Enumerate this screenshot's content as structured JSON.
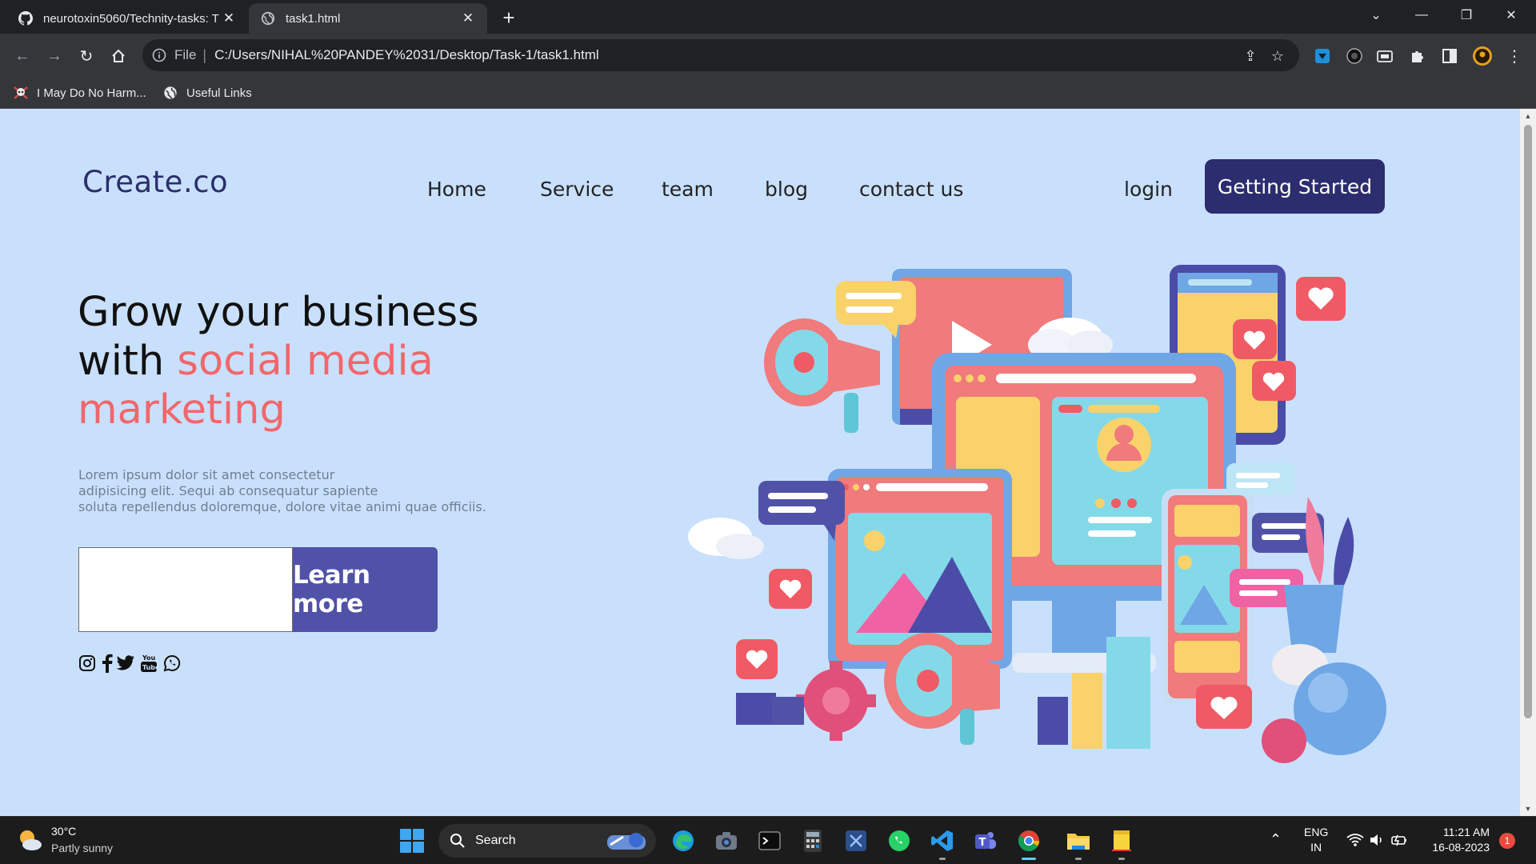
{
  "browser": {
    "tabs": [
      {
        "label": "neurotoxin5060/Technity-tasks: T",
        "icon": "github-icon",
        "active": false
      },
      {
        "label": "task1.html",
        "icon": "globe-icon",
        "active": true
      }
    ],
    "address": {
      "scheme": "File",
      "url": "C:/Users/NIHAL%20PANDEY%2031/Desktop/Task-1/task1.html"
    },
    "bookmarks": [
      {
        "label": "I May Do No Harm...",
        "icon": "skull-icon"
      },
      {
        "label": "Useful Links",
        "icon": "globe-icon"
      }
    ]
  },
  "page": {
    "logo": "Create.co",
    "nav": [
      "Home",
      "Service",
      "team",
      "blog",
      "contact us"
    ],
    "login": "login",
    "cta": "Getting Started",
    "hero": {
      "title_line1": "Grow your business",
      "title_with": "with",
      "title_accent1": "social media",
      "title_accent2": "marketing",
      "text_line1": "Lorem ipsum dolor sit amet consectetur",
      "text_line2": "adipisicing elit. Sequi ab consequatur sapiente",
      "text_line3": "soluta repellendus doloremque, dolore vitae animi quae officiis.",
      "input_value": "",
      "button": "Learn more"
    },
    "social_icons": [
      "instagram-icon",
      "facebook-icon",
      "twitter-icon",
      "youtube-icon",
      "whatsapp-icon"
    ],
    "colors": {
      "background": "#c9e0fc",
      "cta": "#2b2d6e",
      "accent": "#f0676b",
      "button": "#5052a8"
    }
  },
  "taskbar": {
    "weather": {
      "temp": "30°C",
      "desc": "Partly sunny"
    },
    "search": "Search",
    "apps": [
      "edge-icon",
      "camera-icon",
      "terminal-icon",
      "calculator-icon",
      "snipping-icon",
      "whatsapp-icon",
      "vscode-icon",
      "teams-icon",
      "chrome-icon",
      "file-explorer-icon",
      "sticky-notes-icon"
    ],
    "lang": {
      "line1": "ENG",
      "line2": "IN"
    },
    "time": "11:21 AM",
    "date": "16-08-2023",
    "notifications": "1"
  }
}
